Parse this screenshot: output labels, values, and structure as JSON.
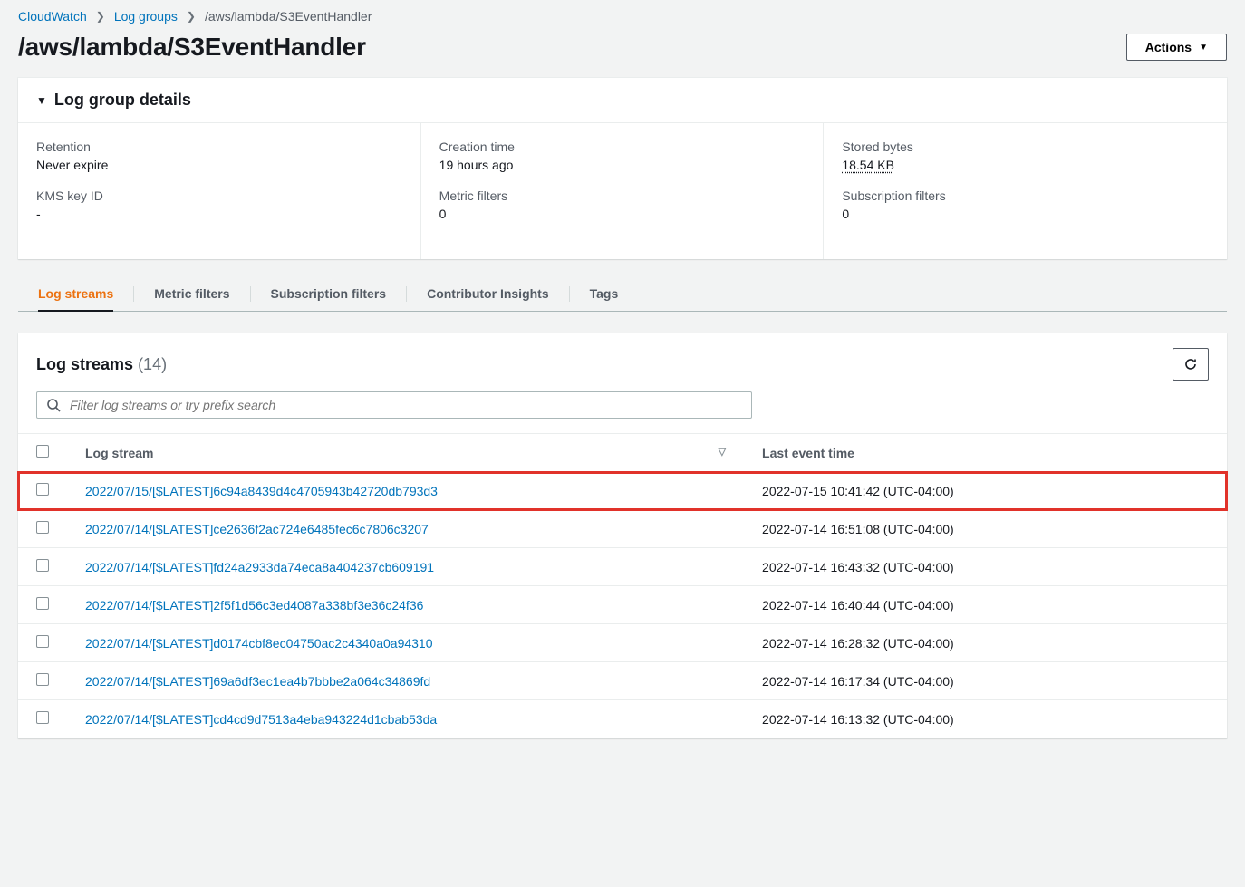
{
  "breadcrumb": {
    "root": "CloudWatch",
    "mid": "Log groups",
    "current": "/aws/lambda/S3EventHandler"
  },
  "page_title": "/aws/lambda/S3EventHandler",
  "actions_label": "Actions",
  "details": {
    "header": "Log group details",
    "retention": {
      "label": "Retention",
      "value": "Never expire"
    },
    "kms": {
      "label": "KMS key ID",
      "value": "-"
    },
    "creation": {
      "label": "Creation time",
      "value": "19 hours ago"
    },
    "metric_filters": {
      "label": "Metric filters",
      "value": "0"
    },
    "stored_bytes": {
      "label": "Stored bytes",
      "value": "18.54 KB"
    },
    "sub_filters": {
      "label": "Subscription filters",
      "value": "0"
    }
  },
  "tabs": {
    "0": "Log streams",
    "1": "Metric filters",
    "2": "Subscription filters",
    "3": "Contributor Insights",
    "4": "Tags"
  },
  "streams_section": {
    "title": "Log streams",
    "count": "(14)",
    "search_placeholder": "Filter log streams or try prefix search",
    "col_stream": "Log stream",
    "col_time": "Last event time"
  },
  "streams": [
    {
      "name": "2022/07/15/[$LATEST]6c94a8439d4c4705943b42720db793d3",
      "time": "2022-07-15 10:41:42 (UTC-04:00)",
      "highlight": true
    },
    {
      "name": "2022/07/14/[$LATEST]ce2636f2ac724e6485fec6c7806c3207",
      "time": "2022-07-14 16:51:08 (UTC-04:00)"
    },
    {
      "name": "2022/07/14/[$LATEST]fd24a2933da74eca8a404237cb609191",
      "time": "2022-07-14 16:43:32 (UTC-04:00)"
    },
    {
      "name": "2022/07/14/[$LATEST]2f5f1d56c3ed4087a338bf3e36c24f36",
      "time": "2022-07-14 16:40:44 (UTC-04:00)"
    },
    {
      "name": "2022/07/14/[$LATEST]d0174cbf8ec04750ac2c4340a0a94310",
      "time": "2022-07-14 16:28:32 (UTC-04:00)"
    },
    {
      "name": "2022/07/14/[$LATEST]69a6df3ec1ea4b7bbbe2a064c34869fd",
      "time": "2022-07-14 16:17:34 (UTC-04:00)"
    },
    {
      "name": "2022/07/14/[$LATEST]cd4cd9d7513a4eba943224d1cbab53da",
      "time": "2022-07-14 16:13:32 (UTC-04:00)"
    }
  ]
}
